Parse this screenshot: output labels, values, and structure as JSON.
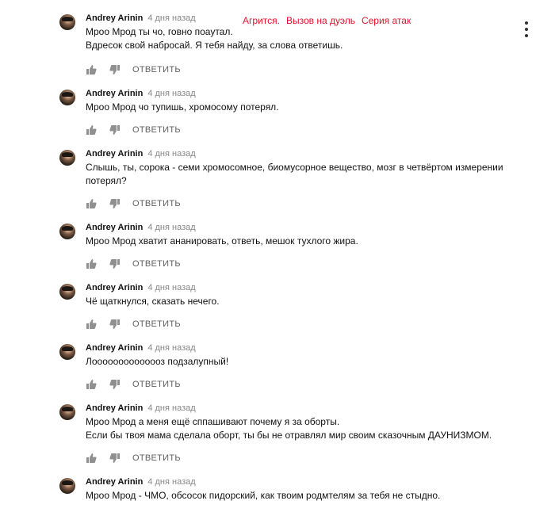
{
  "overlay": {
    "label1": "Агрится.",
    "label2": "Вызов на дуэль",
    "label3": "Серия атак"
  },
  "comments": [
    {
      "author": "Andrey Arinin",
      "time": "4 дня назад",
      "lines": [
        "Мроо Мрод ты чо, говно поаутал.",
        "Вдресок свой набросай. Я тебя найду, за слова ответишь."
      ],
      "reply": "ОТВЕТИТЬ"
    },
    {
      "author": "Andrey Arinin",
      "time": "4 дня назад",
      "lines": [
        "Мроо Мрод чо тупишь, хромосому потерял."
      ],
      "reply": "ОТВЕТИТЬ"
    },
    {
      "author": "Andrey Arinin",
      "time": "4 дня назад",
      "lines": [
        "Слышь, ты, сорока - семи хромосомное, биомусорное вещество, мозг в четвёртом измерении",
        "потерял?"
      ],
      "reply": "ОТВЕТИТЬ"
    },
    {
      "author": "Andrey Arinin",
      "time": "4 дня назад",
      "lines": [
        "Мроо Мрод хватит ананировать, ответь, мешок тухлого жира."
      ],
      "reply": "ОТВЕТИТЬ"
    },
    {
      "author": "Andrey Arinin",
      "time": "4 дня назад",
      "lines": [
        "Чё щаткнулся, сказать нечего."
      ],
      "reply": "ОТВЕТИТЬ"
    },
    {
      "author": "Andrey Arinin",
      "time": "4 дня назад",
      "lines": [
        "Лоооооооооооооз подзалупный!"
      ],
      "reply": "ОТВЕТИТЬ"
    },
    {
      "author": "Andrey Arinin",
      "time": "4 дня назад",
      "lines": [
        "Мроо Мрод а меня ещё сппашивают почему я за оборты.",
        "Если бы твоя мама сделала оборт, ты бы не отравлял мир своим сказочным ДАУНИЗМОМ."
      ],
      "reply": "ОТВЕТИТЬ"
    },
    {
      "author": "Andrey Arinin",
      "time": "4 дня назад",
      "lines": [
        "Мроо Мрод - ЧМО, обсосок пидорский, как твоим родмтелям за тебя не стыдно."
      ],
      "reply": ""
    }
  ]
}
